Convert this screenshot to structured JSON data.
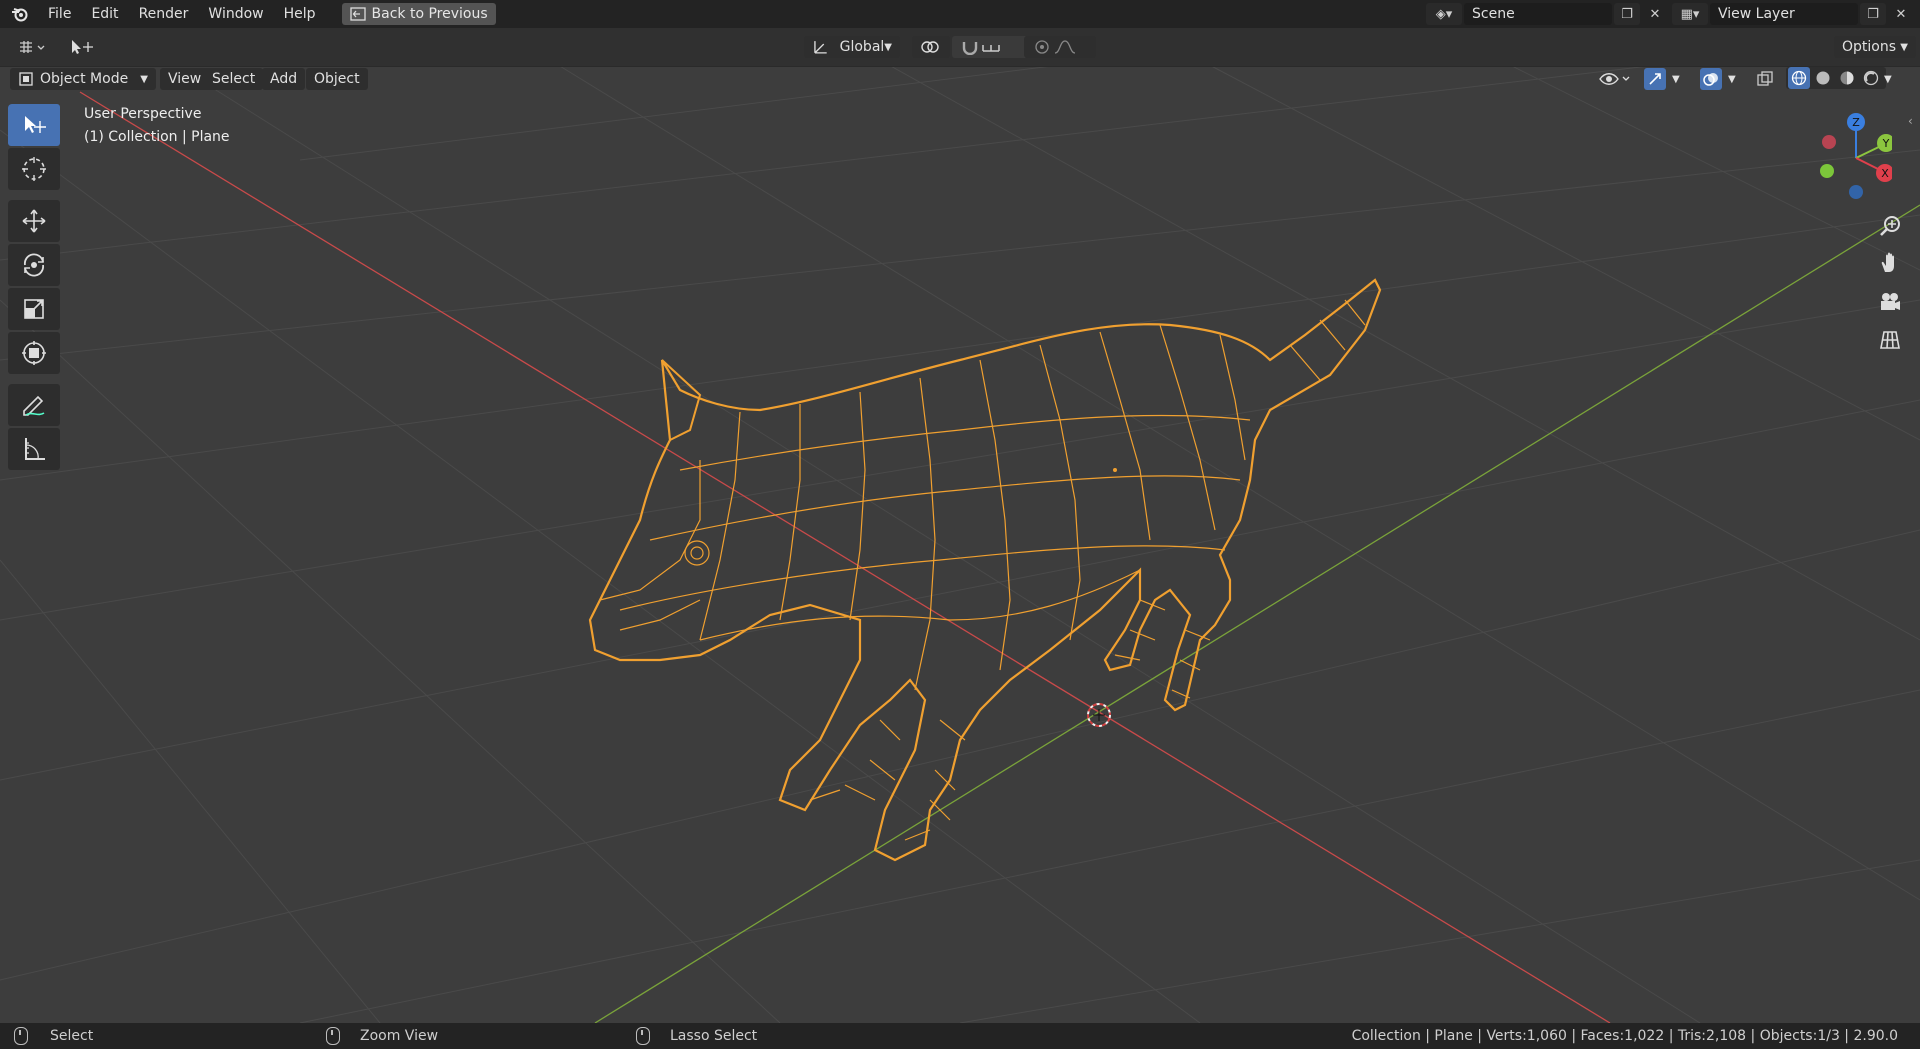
{
  "menu": {
    "items": [
      "File",
      "Edit",
      "Render",
      "Window",
      "Help"
    ],
    "back_label": "Back to Previous"
  },
  "scene": {
    "name": "Scene",
    "view_layer": "View Layer"
  },
  "header": {
    "transform_orientation": "Global",
    "options_label": "Options",
    "mode": "Object Mode",
    "menus": [
      "View",
      "Select",
      "Add",
      "Object"
    ]
  },
  "viewport": {
    "perspective_label": "User Perspective",
    "collection_label": "(1) Collection | Plane",
    "gizmo": {
      "z": "Z",
      "y": "Y",
      "x": "X"
    }
  },
  "status": {
    "select": "Select",
    "zoom": "Zoom View",
    "lasso": "Lasso Select",
    "stats": "Collection | Plane | Verts:1,060 | Faces:1,022 | Tris:2,108 | Objects:1/3 | 2.90.0"
  },
  "colors": {
    "accent": "#4772b3",
    "wire": "#f0a030",
    "axis_x": "#c84a4a",
    "axis_y": "#7aa33a",
    "gizmo_z": "#3a7fe0",
    "gizmo_y": "#8cc63f",
    "gizmo_x": "#e0404c"
  }
}
